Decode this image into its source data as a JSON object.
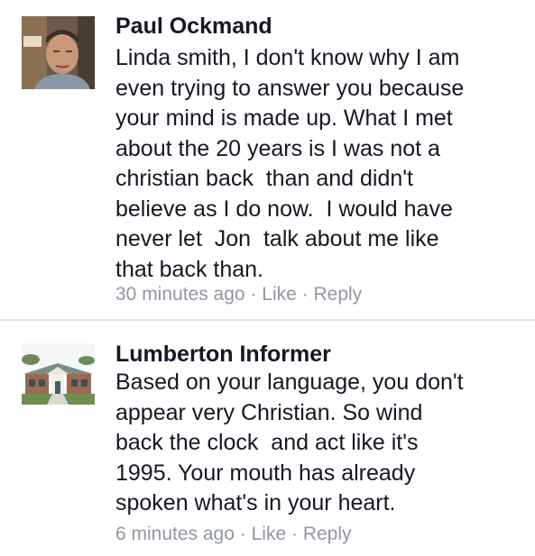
{
  "comments": [
    {
      "author": "Paul Ockmand",
      "lines": [
        "Linda smith, I don't know why I am",
        "even trying to answer you because",
        "your mind is made up. What I met",
        "about the 20 years is I was not a",
        "christian back  than and didn't",
        "believe as I do now.  I would have",
        "never let  Jon  talk about me like",
        "that back than."
      ],
      "timestamp": "30 minutes ago",
      "like_label": "Like",
      "reply_label": "Reply"
    },
    {
      "author": "Lumberton Informer",
      "lines": [
        "Based on your language, you don't",
        "appear very Christian. So wind",
        "back the clock  and act like it's",
        "1995. Your mouth has already",
        "spoken what's in your heart."
      ],
      "timestamp": "6 minutes ago",
      "like_label": "Like",
      "reply_label": "Reply"
    }
  ],
  "separator": "·",
  "colors": {
    "text": "#141823",
    "meta": "#9197a3",
    "divider": "#e3e4e8"
  }
}
